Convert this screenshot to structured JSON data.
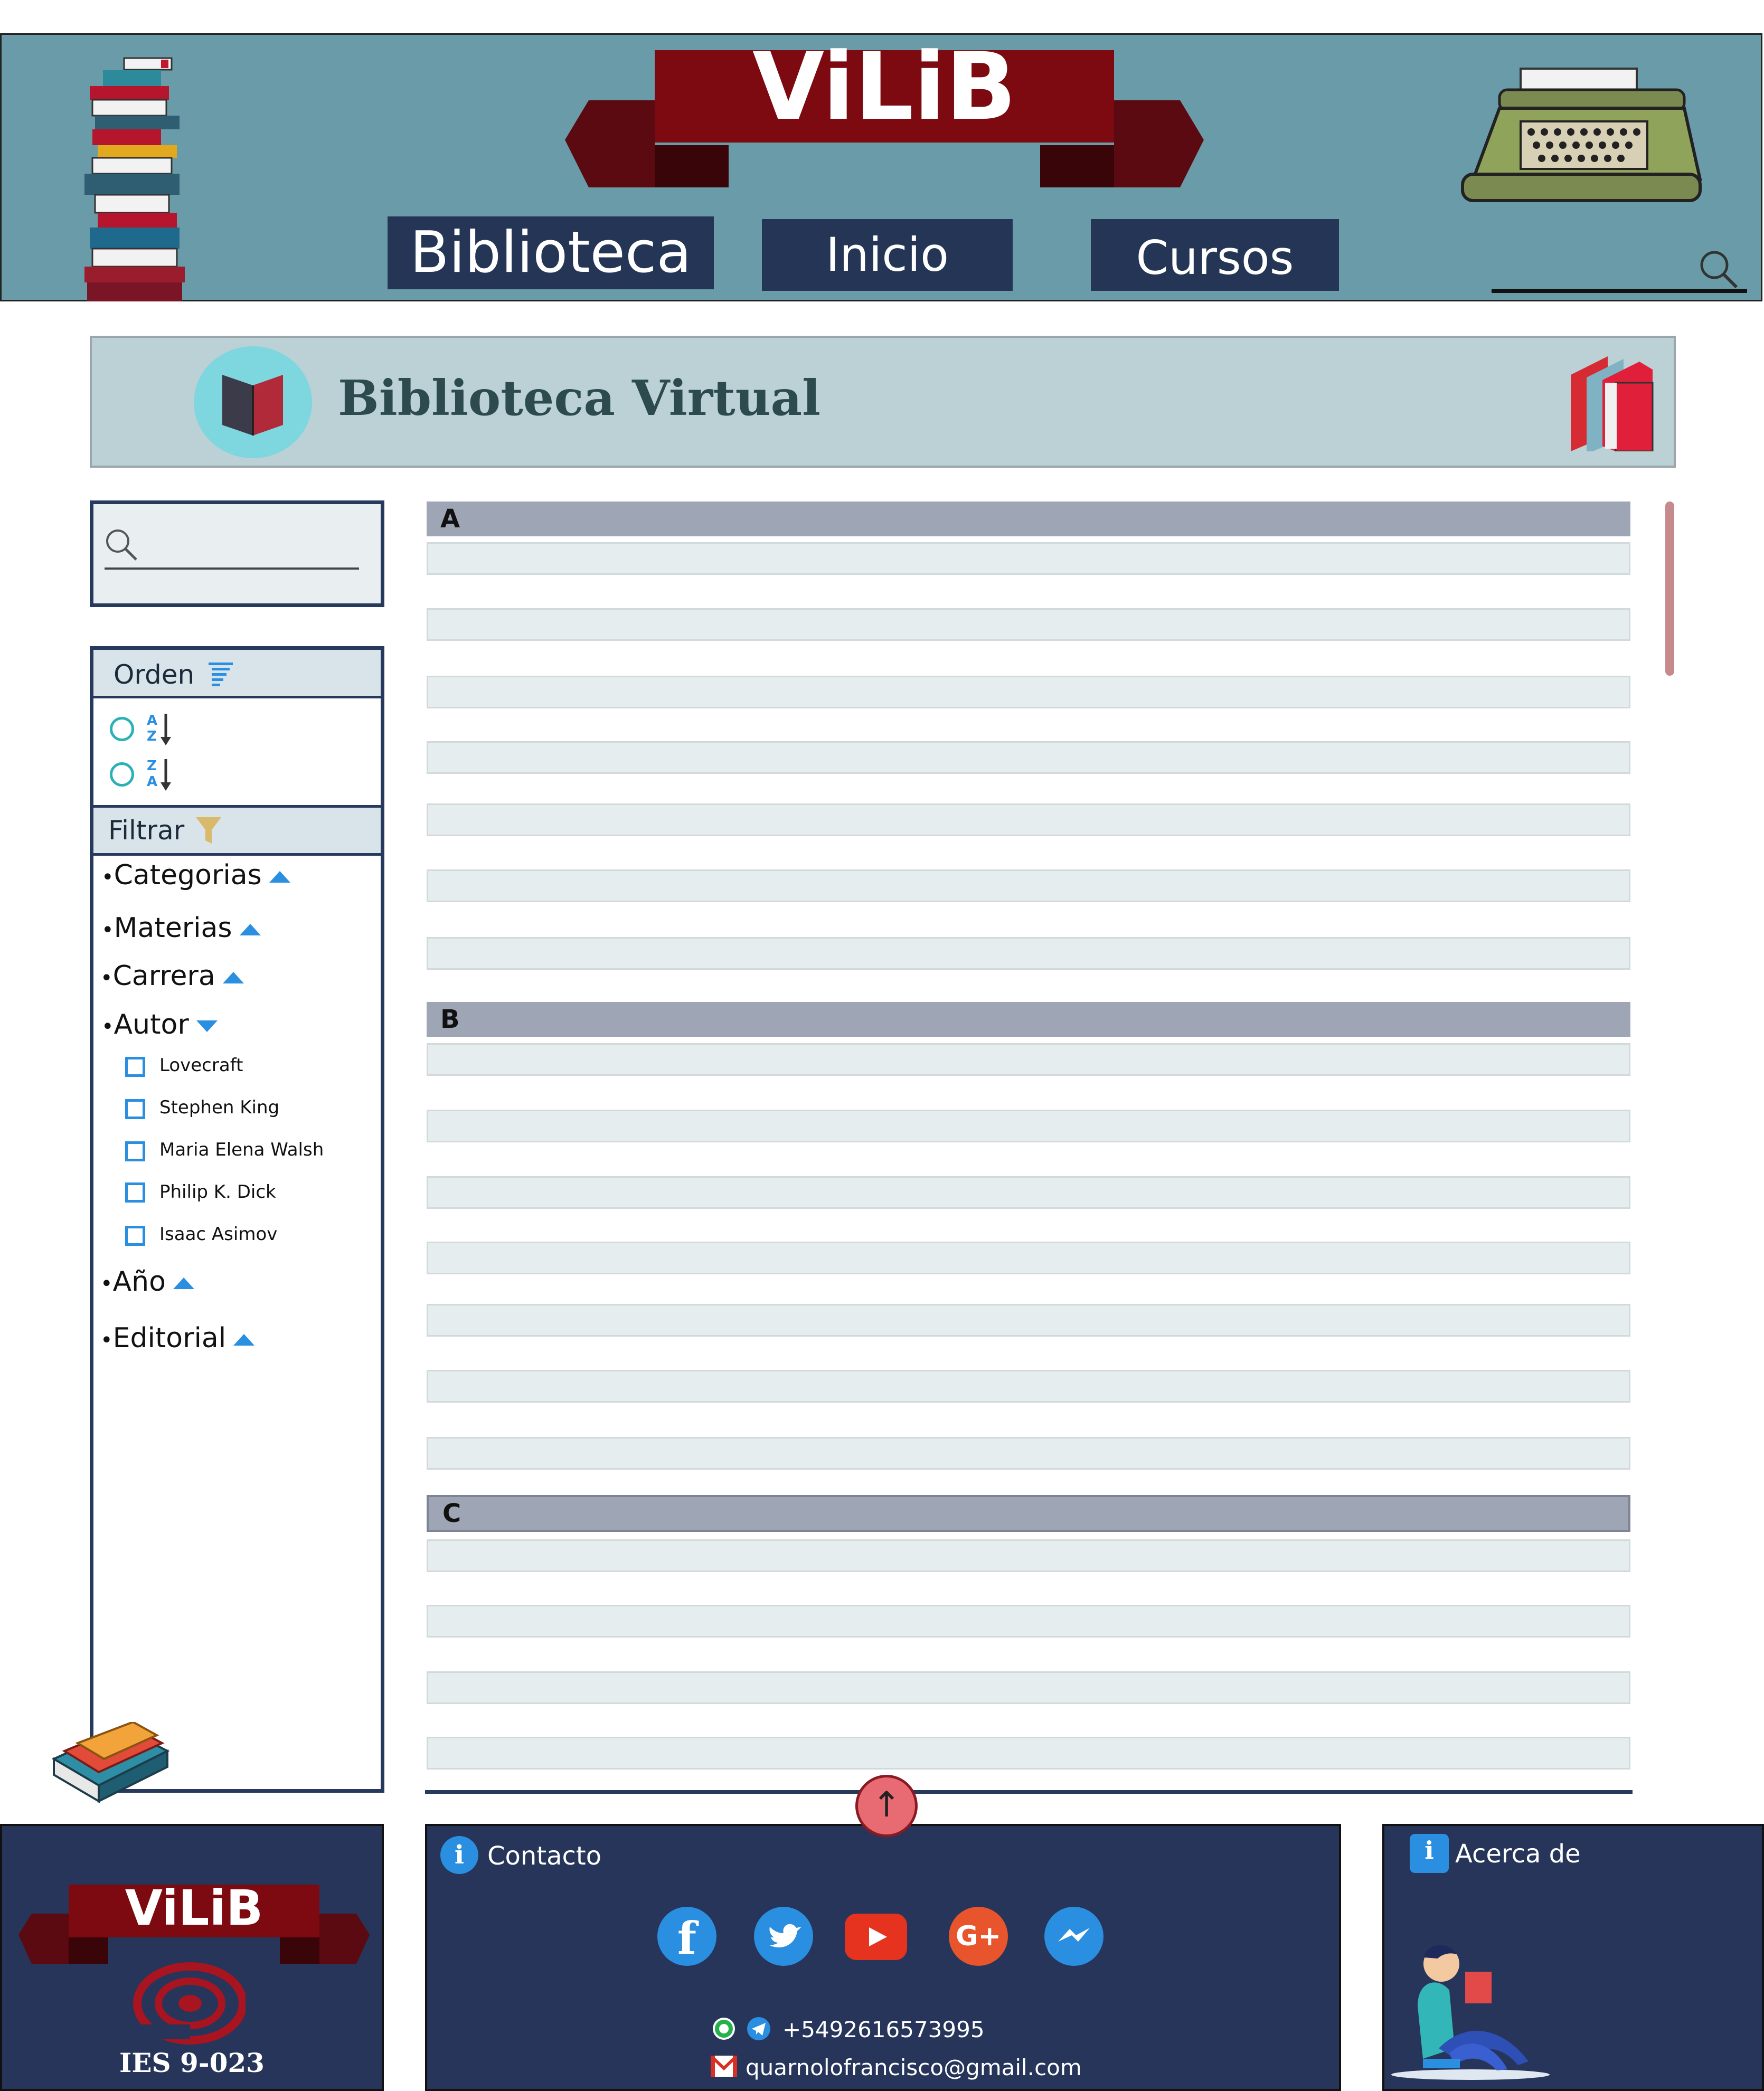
{
  "header": {
    "logo_text": "ViLiB",
    "nav": {
      "biblioteca": "Biblioteca",
      "inicio": "Inicio",
      "cursos": "Cursos"
    }
  },
  "banner": {
    "title": "Biblioteca Virtual"
  },
  "sidebar": {
    "order_label": "Orden",
    "sort_az": {
      "top": "A",
      "bottom": "Z"
    },
    "sort_za": {
      "top": "Z",
      "bottom": "A"
    },
    "filter_label": "Filtrar",
    "filters": {
      "categorias": "Categorias",
      "materias": "Materias",
      "carrera": "Carrera",
      "autor": "Autor",
      "anio": "Año",
      "editorial": "Editorial"
    },
    "authors": [
      "Lovecraft",
      "Stephen King",
      "Maria Elena Walsh",
      "Philip K. Dick",
      "Isaac Asimov"
    ]
  },
  "list": {
    "sections": [
      "A",
      "B",
      "C"
    ]
  },
  "footer": {
    "logo_text": "ViLiB",
    "institute": "IES 9-023",
    "contact_title": "Contacto",
    "phone": "+5492616573995",
    "email": "quarnolofrancisco@gmail.com",
    "about_title": "Acerca de"
  },
  "colors": {
    "header_bg": "#699ca8",
    "nav_bg": "#253556",
    "logo_red": "#7d0a10",
    "banner_bg": "#bbd1d6",
    "section_head": "#9ea5b5",
    "row_bg": "#e6edef",
    "footer_bg": "#263559",
    "accent_blue": "#2a8fe0"
  },
  "icons": [
    "book-stack-icon",
    "typewriter-icon",
    "search-icon",
    "open-book-icon",
    "books-icon",
    "sort-lines-icon",
    "sort-az-icon",
    "sort-za-icon",
    "funnel-icon",
    "info-icon",
    "facebook-icon",
    "twitter-icon",
    "youtube-icon",
    "google-plus-icon",
    "messenger-icon",
    "whatsapp-icon",
    "telegram-icon",
    "mail-icon",
    "reader-illustration-icon",
    "books-pile-icon",
    "arrow-up-icon"
  ]
}
